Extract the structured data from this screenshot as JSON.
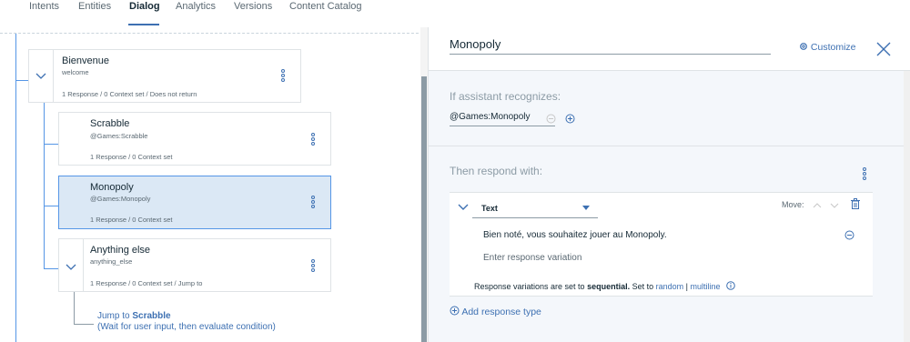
{
  "topnav": {
    "tabs": [
      {
        "label": "Intents"
      },
      {
        "label": "Entities"
      },
      {
        "label": "Dialog"
      },
      {
        "label": "Analytics"
      },
      {
        "label": "Versions"
      },
      {
        "label": "Content Catalog"
      }
    ],
    "active": "Dialog"
  },
  "tree": {
    "nodes": [
      {
        "title": "Bienvenue",
        "condition": "welcome",
        "meta": "1 Response / 0 Context set / Does not return"
      },
      {
        "title": "Scrabble",
        "condition": "@Games:Scrabble",
        "meta": "1 Response / 0 Context set"
      },
      {
        "title": "Monopoly",
        "condition": "@Games:Monopoly",
        "meta": "1 Response / 0 Context set"
      },
      {
        "title": "Anything else",
        "condition": "anything_else",
        "meta": "1 Response / 0 Context set / Jump to"
      }
    ],
    "jump": {
      "prefix": "Jump to ",
      "target": "Scrabble",
      "note": "(Wait for user input, then evaluate condition)"
    }
  },
  "panel": {
    "node_name": "Monopoly",
    "customize_label": "Customize",
    "if_label": "If assistant recognizes:",
    "condition_value": "@Games:Monopoly",
    "then_label": "Then respond with:",
    "response": {
      "type": "Text",
      "move_label": "Move:",
      "variations": [
        "Bien noté, vous souhaitez jouer au Monopoly."
      ],
      "placeholder": "Enter response variation",
      "seq_prefix": "Response variations are set to ",
      "seq_mode": "sequential.",
      "seq_set": " Set to ",
      "random_label": "random",
      "sep": " | ",
      "multiline_label": "multiline"
    },
    "add_response_label": "Add response type"
  },
  "colors": {
    "accent": "#3d70b2",
    "selected_bg": "#dbe8f5",
    "tree_line": "#5596e6"
  }
}
